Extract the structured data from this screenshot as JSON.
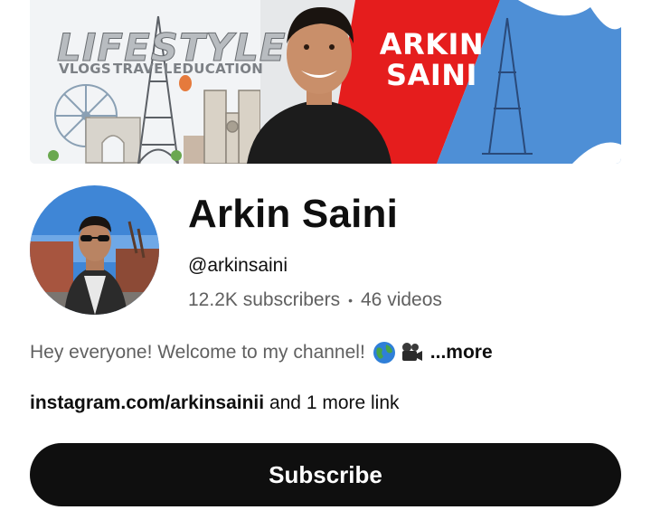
{
  "banner": {
    "headline": "LIFESTYLE",
    "tags": [
      "VLOGS",
      "TRAVEL",
      "EDUCATION"
    ],
    "title_line1": "ARKIN",
    "title_line2": "SAINI"
  },
  "channel": {
    "name": "Arkin Saini",
    "handle": "@arkinsaini",
    "subscribers": "12.2K subscribers",
    "separator": "•",
    "videos": "46 videos"
  },
  "description": {
    "text": "Hey everyone! Welcome to my channel!",
    "emojis": [
      "globe-icon",
      "movie-camera-icon"
    ],
    "more_label": "...more"
  },
  "links": {
    "url": "instagram.com/arkinsainii",
    "suffix": " and 1 more link"
  },
  "subscribe": {
    "label": "Subscribe"
  },
  "colors": {
    "button_bg": "#0f0f0f",
    "banner_red": "#e51d1d",
    "secondary_text": "#606060"
  }
}
